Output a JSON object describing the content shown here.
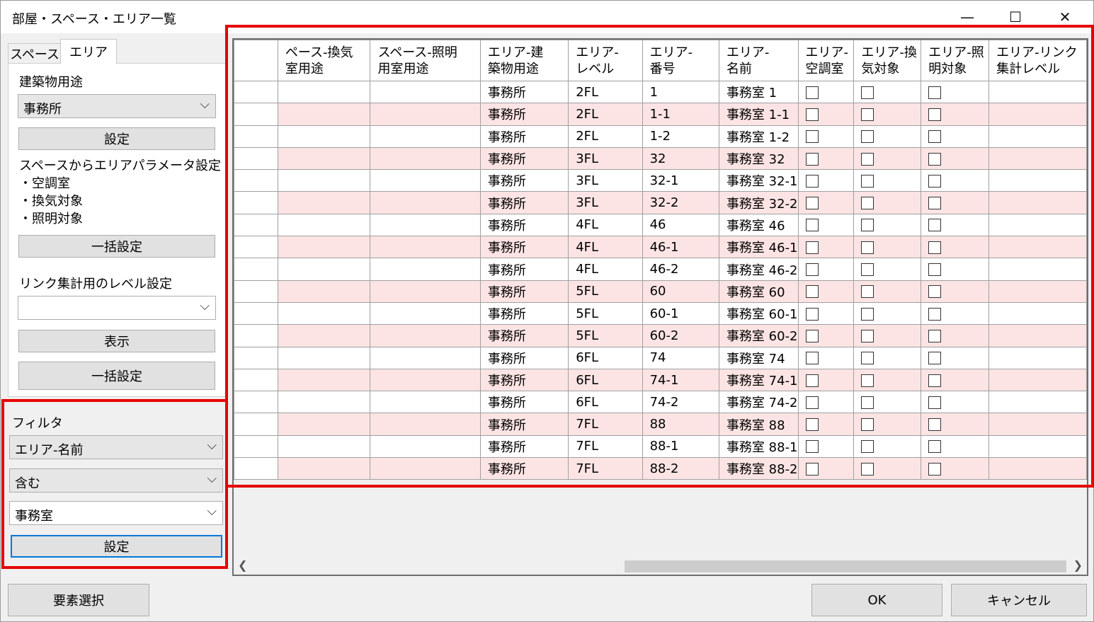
{
  "window": {
    "title": "部屋・スペース・エリア一覧",
    "minimize": "—",
    "maximize": "☐",
    "close": "✕"
  },
  "tabs": [
    {
      "label": "スペース"
    },
    {
      "label": "エリア"
    }
  ],
  "left": {
    "building_use_label": "建築物用途",
    "building_use_value": "事務所",
    "set_button": "設定",
    "space_area_label": "スペースからエリアパラメータ設定",
    "space_area_items": [
      "・空調室",
      "・換気対象",
      "・照明対象"
    ],
    "bulk_button_1": "一括設定",
    "link_level_label": "リンク集計用のレベル設定",
    "link_level_value": "",
    "show_button": "表示",
    "bulk_button_2": "一括設定"
  },
  "filter": {
    "label": "フィルタ",
    "field": "エリア-名前",
    "condition": "含む",
    "value": "事務室",
    "set_button": "設定"
  },
  "grid": {
    "headers": [
      [
        "ペース-換気",
        "室用途"
      ],
      [
        "スペース-照明",
        "用室用途"
      ],
      [
        "エリア-建",
        "築物用途"
      ],
      [
        "エリア-",
        "レベル"
      ],
      [
        "エリア-",
        "番号"
      ],
      [
        "エリア-",
        "名前"
      ],
      [
        "エリア-",
        "空調室"
      ],
      [
        "エリア-換",
        "気対象"
      ],
      [
        "エリア-照",
        "明対象"
      ],
      [
        "エリア-リンク",
        "集計レベル"
      ]
    ],
    "rows": [
      [
        "事務所",
        "2FL",
        "1",
        "事務室 1"
      ],
      [
        "事務所",
        "2FL",
        "1-1",
        "事務室 1-1"
      ],
      [
        "事務所",
        "2FL",
        "1-2",
        "事務室 1-2"
      ],
      [
        "事務所",
        "3FL",
        "32",
        "事務室 32"
      ],
      [
        "事務所",
        "3FL",
        "32-1",
        "事務室 32-1"
      ],
      [
        "事務所",
        "3FL",
        "32-2",
        "事務室 32-2"
      ],
      [
        "事務所",
        "4FL",
        "46",
        "事務室 46"
      ],
      [
        "事務所",
        "4FL",
        "46-1",
        "事務室 46-1"
      ],
      [
        "事務所",
        "4FL",
        "46-2",
        "事務室 46-2"
      ],
      [
        "事務所",
        "5FL",
        "60",
        "事務室 60"
      ],
      [
        "事務所",
        "5FL",
        "60-1",
        "事務室 60-1"
      ],
      [
        "事務所",
        "5FL",
        "60-2",
        "事務室 60-2"
      ],
      [
        "事務所",
        "6FL",
        "74",
        "事務室 74"
      ],
      [
        "事務所",
        "6FL",
        "74-1",
        "事務室 74-1"
      ],
      [
        "事務所",
        "6FL",
        "74-2",
        "事務室 74-2"
      ],
      [
        "事務所",
        "7FL",
        "88",
        "事務室 88"
      ],
      [
        "事務所",
        "7FL",
        "88-1",
        "事務室 88-1"
      ],
      [
        "事務所",
        "7FL",
        "88-2",
        "事務室 88-2"
      ]
    ]
  },
  "bottom": {
    "select_elements": "要素選択",
    "ok": "OK",
    "cancel": "キャンセル"
  },
  "colors": {
    "highlight": "#e60000",
    "row_alt": "#fde4e4",
    "focus": "#0078d7"
  }
}
